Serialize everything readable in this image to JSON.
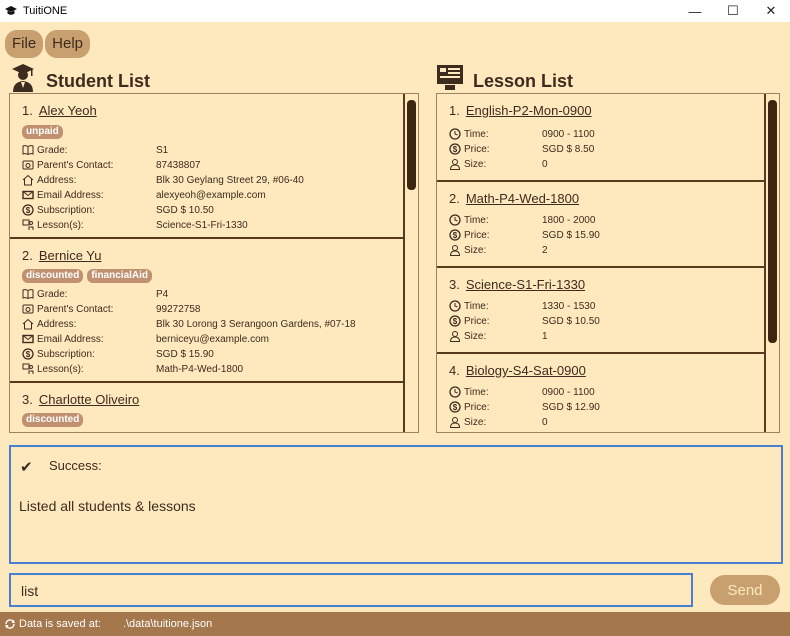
{
  "window": {
    "title": "TuitiONE",
    "minimize": "—",
    "maximize": "☐",
    "close": "✕"
  },
  "menu": {
    "file": "File",
    "help": "Help"
  },
  "students": {
    "title": "Student List",
    "items": [
      {
        "index": "1.",
        "name": "Alex Yeoh",
        "tags": [
          "unpaid"
        ],
        "fields": [
          {
            "icon": "book-icon",
            "label": "Grade:",
            "value": "S1"
          },
          {
            "icon": "phone-icon",
            "label": "Parent's Contact:",
            "value": "87438807"
          },
          {
            "icon": "home-icon",
            "label": "Address:",
            "value": "Blk 30 Geylang Street 29, #06-40"
          },
          {
            "icon": "mail-icon",
            "label": "Email Address:",
            "value": "alexyeoh@example.com"
          },
          {
            "icon": "dollar-icon",
            "label": "Subscription:",
            "value": "SGD $ 10.50"
          },
          {
            "icon": "lesson-icon",
            "label": "Lesson(s):",
            "value": "Science-S1-Fri-1330"
          }
        ]
      },
      {
        "index": "2.",
        "name": "Bernice Yu",
        "tags": [
          "discounted",
          "financialAid"
        ],
        "fields": [
          {
            "icon": "book-icon",
            "label": "Grade:",
            "value": "P4"
          },
          {
            "icon": "phone-icon",
            "label": "Parent's Contact:",
            "value": "99272758"
          },
          {
            "icon": "home-icon",
            "label": "Address:",
            "value": "Blk 30 Lorong 3 Serangoon Gardens, #07-18"
          },
          {
            "icon": "mail-icon",
            "label": "Email Address:",
            "value": "berniceyu@example.com"
          },
          {
            "icon": "dollar-icon",
            "label": "Subscription:",
            "value": "SGD $ 15.90"
          },
          {
            "icon": "lesson-icon",
            "label": "Lesson(s):",
            "value": "Math-P4-Wed-1800"
          }
        ]
      },
      {
        "index": "3.",
        "name": "Charlotte Oliveiro",
        "tags": [
          "discounted"
        ],
        "fields": []
      }
    ]
  },
  "lessons": {
    "title": "Lesson List",
    "items": [
      {
        "index": "1.",
        "name": "English-P2-Mon-0900",
        "time": "0900 - 1100",
        "price": "SGD $ 8.50",
        "size": "0"
      },
      {
        "index": "2.",
        "name": "Math-P4-Wed-1800",
        "time": "1800 - 2000",
        "price": "SGD $ 15.90",
        "size": "2"
      },
      {
        "index": "3.",
        "name": "Science-S1-Fri-1330",
        "time": "1330 - 1530",
        "price": "SGD $ 10.50",
        "size": "1"
      },
      {
        "index": "4.",
        "name": "Biology-S4-Sat-0900",
        "time": "0900 - 1100",
        "price": "SGD $ 12.90",
        "size": "0"
      }
    ],
    "labels": {
      "time": "Time:",
      "price": "Price:",
      "size": "Size:"
    }
  },
  "result": {
    "status": "Success:",
    "message": "Listed all students & lessons"
  },
  "command": {
    "value": "list",
    "send_label": "Send"
  },
  "status_bar": {
    "label": "Data is saved at:",
    "path": ".\\data\\tuitione.json"
  },
  "colors": {
    "background": "#fde9bd",
    "accent": "#c8a06f",
    "text": "#3d2b1f",
    "status_bar": "#a5774c",
    "focus_border": "#4a7fd0"
  }
}
